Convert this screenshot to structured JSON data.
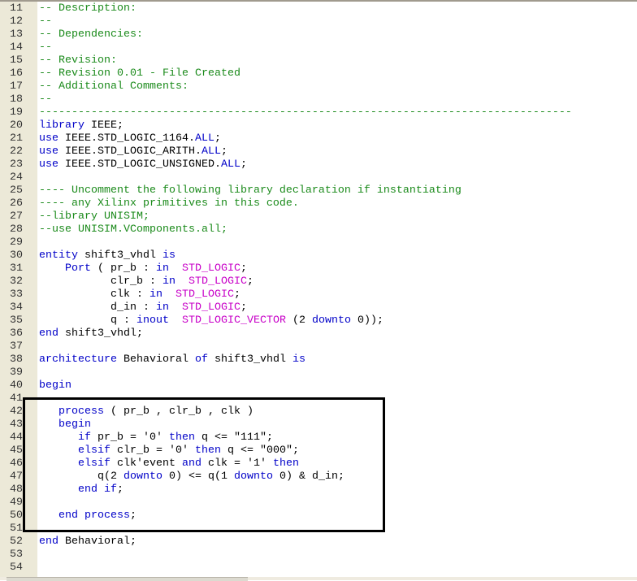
{
  "editor": {
    "language": "VHDL",
    "colors": {
      "comment": "#1a8a1a",
      "keyword": "#0000c8",
      "type": "#c800c8",
      "gutter": "#ece9d8",
      "highlight_box": "#000000"
    },
    "highlight_box_lines": [
      "41",
      "51"
    ],
    "lines": [
      {
        "num": "11",
        "segs": [
          {
            "t": "-- Description:",
            "c": "cm"
          }
        ]
      },
      {
        "num": "12",
        "segs": [
          {
            "t": "--",
            "c": "cm"
          }
        ]
      },
      {
        "num": "13",
        "segs": [
          {
            "t": "-- Dependencies:",
            "c": "cm"
          }
        ]
      },
      {
        "num": "14",
        "segs": [
          {
            "t": "--",
            "c": "cm"
          }
        ]
      },
      {
        "num": "15",
        "segs": [
          {
            "t": "-- Revision:",
            "c": "cm"
          }
        ]
      },
      {
        "num": "16",
        "segs": [
          {
            "t": "-- Revision 0.01 - File Created",
            "c": "cm"
          }
        ]
      },
      {
        "num": "17",
        "segs": [
          {
            "t": "-- Additional Comments:",
            "c": "cm"
          }
        ]
      },
      {
        "num": "18",
        "segs": [
          {
            "t": "--",
            "c": "cm"
          }
        ]
      },
      {
        "num": "19",
        "segs": [
          {
            "t": "----------------------------------------------------------------------------------",
            "c": "cm"
          }
        ]
      },
      {
        "num": "20",
        "segs": [
          {
            "t": "library",
            "c": "kw"
          },
          {
            "t": " IEEE;",
            "c": "pl"
          }
        ]
      },
      {
        "num": "21",
        "segs": [
          {
            "t": "use",
            "c": "kw"
          },
          {
            "t": " IEEE.STD_LOGIC_1164.",
            "c": "pl"
          },
          {
            "t": "ALL",
            "c": "kw"
          },
          {
            "t": ";",
            "c": "pl"
          }
        ]
      },
      {
        "num": "22",
        "segs": [
          {
            "t": "use",
            "c": "kw"
          },
          {
            "t": " IEEE.STD_LOGIC_ARITH.",
            "c": "pl"
          },
          {
            "t": "ALL",
            "c": "kw"
          },
          {
            "t": ";",
            "c": "pl"
          }
        ]
      },
      {
        "num": "23",
        "segs": [
          {
            "t": "use",
            "c": "kw"
          },
          {
            "t": " IEEE.STD_LOGIC_UNSIGNED.",
            "c": "pl"
          },
          {
            "t": "ALL",
            "c": "kw"
          },
          {
            "t": ";",
            "c": "pl"
          }
        ]
      },
      {
        "num": "24",
        "segs": []
      },
      {
        "num": "25",
        "segs": [
          {
            "t": "---- Uncomment the following library declaration if instantiating",
            "c": "cm"
          }
        ]
      },
      {
        "num": "26",
        "segs": [
          {
            "t": "---- any Xilinx primitives in this code.",
            "c": "cm"
          }
        ]
      },
      {
        "num": "27",
        "segs": [
          {
            "t": "--library UNISIM;",
            "c": "cm"
          }
        ]
      },
      {
        "num": "28",
        "segs": [
          {
            "t": "--use UNISIM.VComponents.all;",
            "c": "cm"
          }
        ]
      },
      {
        "num": "29",
        "segs": []
      },
      {
        "num": "30",
        "segs": [
          {
            "t": "entity",
            "c": "kw"
          },
          {
            "t": " shift3_vhdl ",
            "c": "pl"
          },
          {
            "t": "is",
            "c": "kw"
          }
        ]
      },
      {
        "num": "31",
        "segs": [
          {
            "t": "    ",
            "c": "pl"
          },
          {
            "t": "Port",
            "c": "kw"
          },
          {
            "t": " ( pr_b : ",
            "c": "pl"
          },
          {
            "t": "in",
            "c": "kw"
          },
          {
            "t": "  ",
            "c": "pl"
          },
          {
            "t": "STD_LOGIC",
            "c": "ty"
          },
          {
            "t": ";",
            "c": "pl"
          }
        ]
      },
      {
        "num": "32",
        "segs": [
          {
            "t": "           clr_b : ",
            "c": "pl"
          },
          {
            "t": "in",
            "c": "kw"
          },
          {
            "t": "  ",
            "c": "pl"
          },
          {
            "t": "STD_LOGIC",
            "c": "ty"
          },
          {
            "t": ";",
            "c": "pl"
          }
        ]
      },
      {
        "num": "33",
        "segs": [
          {
            "t": "           clk : ",
            "c": "pl"
          },
          {
            "t": "in",
            "c": "kw"
          },
          {
            "t": "  ",
            "c": "pl"
          },
          {
            "t": "STD_LOGIC",
            "c": "ty"
          },
          {
            "t": ";",
            "c": "pl"
          }
        ]
      },
      {
        "num": "34",
        "segs": [
          {
            "t": "           d_in : ",
            "c": "pl"
          },
          {
            "t": "in",
            "c": "kw"
          },
          {
            "t": "  ",
            "c": "pl"
          },
          {
            "t": "STD_LOGIC",
            "c": "ty"
          },
          {
            "t": ";",
            "c": "pl"
          }
        ]
      },
      {
        "num": "35",
        "segs": [
          {
            "t": "           q : ",
            "c": "pl"
          },
          {
            "t": "inout",
            "c": "kw"
          },
          {
            "t": "  ",
            "c": "pl"
          },
          {
            "t": "STD_LOGIC_VECTOR",
            "c": "ty"
          },
          {
            "t": " (2 ",
            "c": "pl"
          },
          {
            "t": "downto",
            "c": "kw"
          },
          {
            "t": " 0));",
            "c": "pl"
          }
        ]
      },
      {
        "num": "36",
        "segs": [
          {
            "t": "end",
            "c": "kw"
          },
          {
            "t": " shift3_vhdl;",
            "c": "pl"
          }
        ]
      },
      {
        "num": "37",
        "segs": []
      },
      {
        "num": "38",
        "segs": [
          {
            "t": "architecture",
            "c": "kw"
          },
          {
            "t": " Behavioral ",
            "c": "pl"
          },
          {
            "t": "of",
            "c": "kw"
          },
          {
            "t": " shift3_vhdl ",
            "c": "pl"
          },
          {
            "t": "is",
            "c": "kw"
          }
        ]
      },
      {
        "num": "39",
        "segs": []
      },
      {
        "num": "40",
        "segs": [
          {
            "t": "begin",
            "c": "kw"
          }
        ]
      },
      {
        "num": "41",
        "segs": []
      },
      {
        "num": "42",
        "segs": [
          {
            "t": "   ",
            "c": "pl"
          },
          {
            "t": "process",
            "c": "kw"
          },
          {
            "t": " ( pr_b , clr_b , clk )",
            "c": "pl"
          }
        ]
      },
      {
        "num": "43",
        "segs": [
          {
            "t": "   ",
            "c": "pl"
          },
          {
            "t": "begin",
            "c": "kw"
          }
        ]
      },
      {
        "num": "44",
        "segs": [
          {
            "t": "      ",
            "c": "pl"
          },
          {
            "t": "if",
            "c": "kw"
          },
          {
            "t": " pr_b = '0' ",
            "c": "pl"
          },
          {
            "t": "then",
            "c": "kw"
          },
          {
            "t": " q <= \"111\";",
            "c": "pl"
          }
        ]
      },
      {
        "num": "45",
        "segs": [
          {
            "t": "      ",
            "c": "pl"
          },
          {
            "t": "elsif",
            "c": "kw"
          },
          {
            "t": " clr_b = '0' ",
            "c": "pl"
          },
          {
            "t": "then",
            "c": "kw"
          },
          {
            "t": " q <= \"000\";",
            "c": "pl"
          }
        ]
      },
      {
        "num": "46",
        "segs": [
          {
            "t": "      ",
            "c": "pl"
          },
          {
            "t": "elsif",
            "c": "kw"
          },
          {
            "t": " clk'event ",
            "c": "pl"
          },
          {
            "t": "and",
            "c": "kw"
          },
          {
            "t": " clk = '1' ",
            "c": "pl"
          },
          {
            "t": "then",
            "c": "kw"
          }
        ]
      },
      {
        "num": "47",
        "segs": [
          {
            "t": "         q(2 ",
            "c": "pl"
          },
          {
            "t": "downto",
            "c": "kw"
          },
          {
            "t": " 0) <= q(1 ",
            "c": "pl"
          },
          {
            "t": "downto",
            "c": "kw"
          },
          {
            "t": " 0) & d_in;",
            "c": "pl"
          }
        ]
      },
      {
        "num": "48",
        "segs": [
          {
            "t": "      ",
            "c": "pl"
          },
          {
            "t": "end if",
            "c": "kw"
          },
          {
            "t": ";",
            "c": "pl"
          }
        ]
      },
      {
        "num": "49",
        "segs": []
      },
      {
        "num": "50",
        "segs": [
          {
            "t": "   ",
            "c": "pl"
          },
          {
            "t": "end process",
            "c": "kw"
          },
          {
            "t": ";",
            "c": "pl"
          }
        ]
      },
      {
        "num": "51",
        "segs": []
      },
      {
        "num": "52",
        "segs": [
          {
            "t": "end",
            "c": "kw"
          },
          {
            "t": " Behavioral;",
            "c": "pl"
          }
        ]
      },
      {
        "num": "53",
        "segs": []
      },
      {
        "num": "54",
        "segs": []
      }
    ]
  }
}
